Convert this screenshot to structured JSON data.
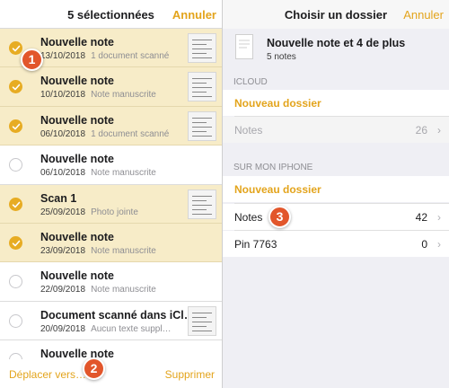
{
  "left_pane": {
    "header": {
      "title": "5 sélectionnées",
      "cancel_label": "Annuler"
    },
    "notes": [
      {
        "title": "Nouvelle note",
        "date": "13/10/2018",
        "desc": "1 document scanné",
        "selected": true,
        "thumb": true
      },
      {
        "title": "Nouvelle note",
        "date": "10/10/2018",
        "desc": "Note manuscrite",
        "selected": true,
        "thumb": true
      },
      {
        "title": "Nouvelle note",
        "date": "06/10/2018",
        "desc": "1 document scanné",
        "selected": true,
        "thumb": true
      },
      {
        "title": "Nouvelle note",
        "date": "06/10/2018",
        "desc": "Note manuscrite",
        "selected": false,
        "thumb": false
      },
      {
        "title": "Scan 1",
        "date": "25/09/2018",
        "desc": "Photo jointe",
        "selected": true,
        "thumb": true
      },
      {
        "title": "Nouvelle note",
        "date": "23/09/2018",
        "desc": "Note manuscrite",
        "selected": true,
        "thumb": false
      },
      {
        "title": "Nouvelle note",
        "date": "22/09/2018",
        "desc": "Note manuscrite",
        "selected": false,
        "thumb": false
      },
      {
        "title": "Document scanné dans iCl…",
        "date": "20/09/2018",
        "desc": "Aucun texte suppl…",
        "selected": false,
        "thumb": true
      },
      {
        "title": "Nouvelle note",
        "date": "",
        "desc": "",
        "selected": false,
        "thumb": false
      }
    ],
    "footer": {
      "move_label": "Déplacer vers…",
      "delete_label": "Supprimer"
    }
  },
  "right_pane": {
    "header": {
      "title": "Choisir un dossier",
      "cancel_label": "Annuler"
    },
    "note_info": {
      "title": "Nouvelle note et 4 de plus",
      "subtitle": "5 notes"
    },
    "icloud": {
      "section_label": "ICLOUD",
      "new_folder_label": "Nouveau dossier",
      "folders": [
        {
          "name": "Notes",
          "count": "26"
        }
      ]
    },
    "iphone": {
      "section_label": "SUR MON IPHONE",
      "new_folder_label": "Nouveau dossier",
      "folders": [
        {
          "name": "Notes",
          "count": "42"
        },
        {
          "name": "Pin 7763",
          "count": "0"
        }
      ]
    }
  },
  "badges": [
    "1",
    "2",
    "3"
  ],
  "colors": {
    "accent": "#e3a41c",
    "selected_row": "#f7ecc8",
    "badge": "#e2562b"
  },
  "icons": {
    "check": "checkmark-icon",
    "chevron": "chevron-right-icon",
    "document": "document-icon"
  }
}
